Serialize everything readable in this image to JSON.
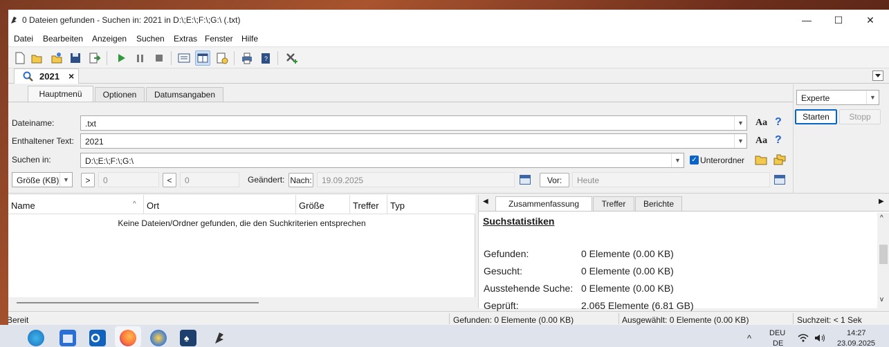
{
  "window": {
    "title": "0 Dateien gefunden - Suchen in: 2021 in D:\\;E:\\;F:\\;G:\\ (.txt)",
    "controls": {
      "minimize": "—",
      "maximize": "☐",
      "close": "✕"
    }
  },
  "menu": [
    "Datei",
    "Bearbeiten",
    "Anzeigen",
    "Suchen",
    "Extras",
    "Fenster",
    "Hilfe"
  ],
  "doc_tab": {
    "label": "2021",
    "close": "×"
  },
  "panel": {
    "tabs": [
      "Hauptmenü",
      "Optionen",
      "Datumsangaben"
    ],
    "labels": {
      "filename": "Dateiname:",
      "content": "Enthaltener Text:",
      "search_in": "Suchen in:",
      "changed": "Geändert:"
    },
    "filename_value": ".txt",
    "content_value": "2021",
    "search_in_value": "D:\\;E:\\;F:\\;G:\\",
    "subfolders_label": "Unterordner",
    "size_unit": "Größe (KB)",
    "size_gt": ">",
    "size_gt_value": "0",
    "size_lt": "<",
    "size_lt_value": "0",
    "after_btn": "Nach:",
    "after_value": "19.09.2025",
    "before_btn": "Vor:",
    "before_value": "Heute",
    "aa": "Aa",
    "help": "?"
  },
  "right_controls": {
    "mode": "Experte",
    "start": "Starten",
    "stop": "Stopp"
  },
  "results": {
    "columns": [
      "Name",
      "Ort",
      "Größe",
      "Treffer",
      "Typ"
    ],
    "empty_message": "Keine Dateien/Ordner gefunden, die den Suchkriterien entsprechen"
  },
  "stats": {
    "tabs": [
      "Zusammenfassung",
      "Treffer",
      "Berichte"
    ],
    "heading": "Suchstatistiken",
    "rows": [
      {
        "label": "Gefunden:",
        "value": "0 Elemente (0.00 KB)"
      },
      {
        "label": "Gesucht:",
        "value": "0 Elemente (0.00 KB)"
      },
      {
        "label": "Ausstehende Suche:",
        "value": "0 Elemente (0.00 KB)"
      },
      {
        "label": "Geprüft:",
        "value": "2.065 Elemente (6.81 GB)"
      }
    ]
  },
  "statusbar": {
    "ready": "Bereit",
    "found": "Gefunden: 0 Elemente (0.00 KB)",
    "selected": "Ausgewählt: 0 Elemente (0.00 KB)",
    "time": "Suchzeit: < 1 Sek"
  },
  "taskbar": {
    "lang_top": "DEU",
    "lang_bottom": "DE",
    "time": "14:27",
    "date": "23.09.2025",
    "chevron": "^"
  },
  "colors": {
    "accent": "#0a64c8",
    "window_bg": "#f0f0f0"
  }
}
